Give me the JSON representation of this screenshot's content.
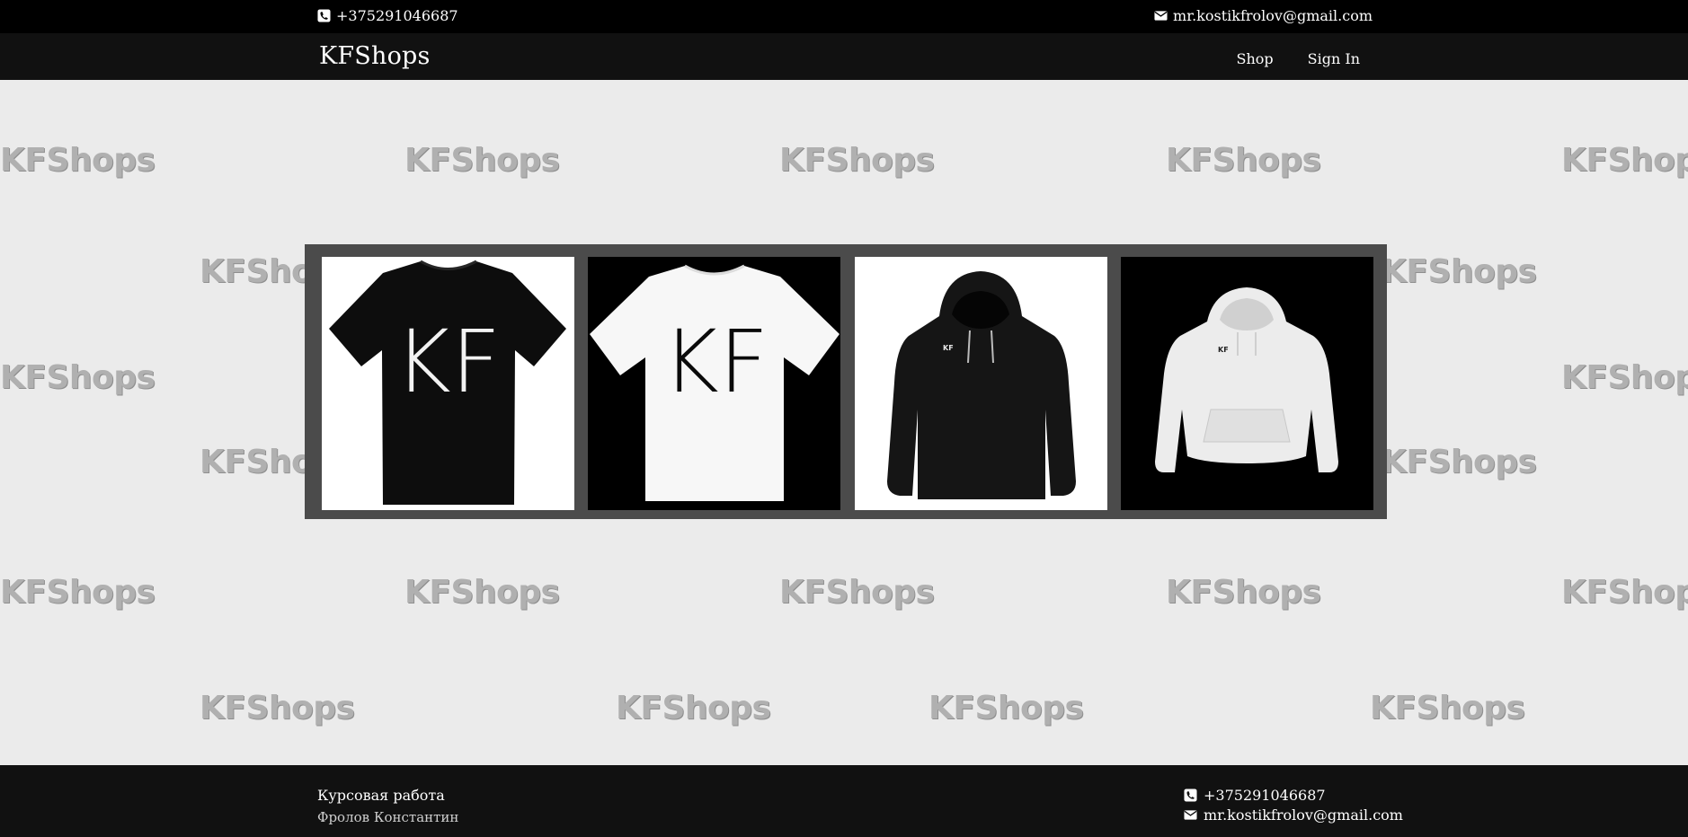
{
  "contact": {
    "phone": "+375291046687",
    "email": "mr.kostikfrolov@gmail.com"
  },
  "brand": "KFShops",
  "nav": {
    "shop": "Shop",
    "signin": "Sign In"
  },
  "watermark_text": "KFShops",
  "products": [
    {
      "icon": "black-tshirt-image",
      "print": "KF"
    },
    {
      "icon": "white-tshirt-image",
      "print": "KF"
    },
    {
      "icon": "black-hoodie-image",
      "print": "KF"
    },
    {
      "icon": "white-hoodie-image",
      "print": "KF"
    }
  ],
  "footer": {
    "course": "Курсовая работа",
    "author": "Фролов Константин",
    "phone": "+375291046687",
    "email": "mr.kostikfrolov@gmail.com"
  },
  "colors": {
    "topbar": "#000000",
    "navbar": "#111111",
    "background": "#ebebeb",
    "gallery_frame": "#4b4b4b",
    "watermark": "#b0b0b0"
  }
}
